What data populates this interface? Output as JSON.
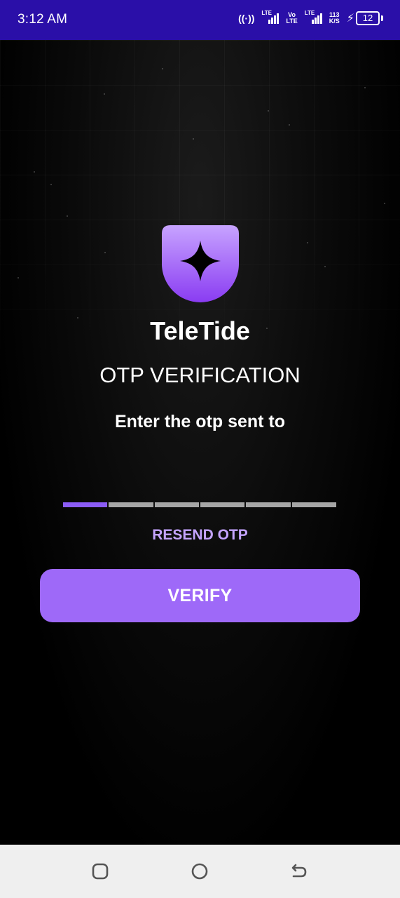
{
  "status_bar": {
    "time": "3:12 AM",
    "signal_label": "LTE",
    "volte_top": "Vo",
    "volte_bottom": "LTE",
    "speed_value": "113",
    "speed_unit": "K/S",
    "battery": "12",
    "icons": [
      "hotspot-icon",
      "signal-icon",
      "volte-icon",
      "signal-icon",
      "charging-icon",
      "battery-icon"
    ]
  },
  "app": {
    "name": "TeleTide",
    "accent_color": "#9e69f8"
  },
  "otp": {
    "title": "OTP VERIFICATION",
    "instruction": "Enter the otp sent to",
    "digits": [
      "",
      "",
      "",
      "",
      "",
      ""
    ],
    "active_index": 0,
    "resend_label": "RESEND OTP",
    "verify_label": "VERIFY"
  },
  "nav_bar": {
    "buttons": [
      "recents-icon",
      "home-icon",
      "back-icon"
    ]
  }
}
